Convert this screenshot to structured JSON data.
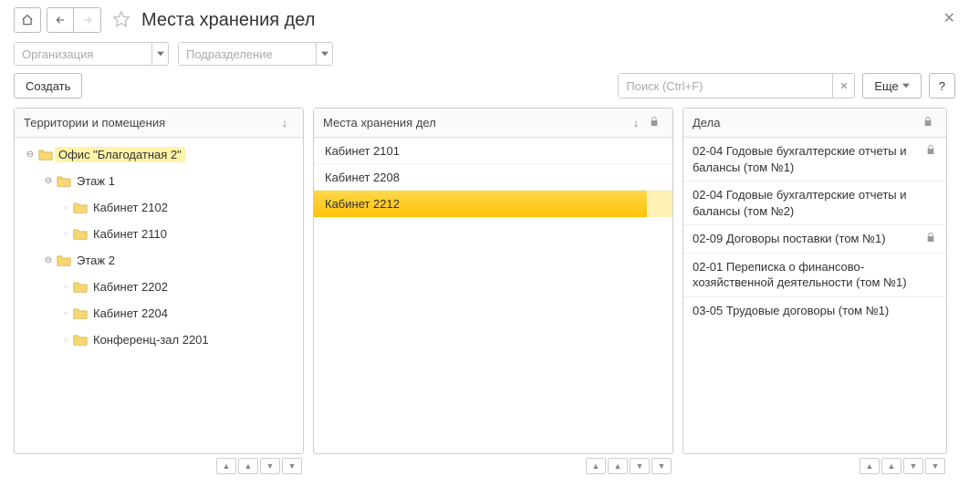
{
  "title": "Места хранения дел",
  "filters": {
    "org_placeholder": "Организация",
    "dept_placeholder": "Подразделение"
  },
  "actions": {
    "create_label": "Создать",
    "more_label": "Еще",
    "help_label": "?"
  },
  "search": {
    "placeholder": "Поиск (Ctrl+F)"
  },
  "panels": {
    "left": {
      "title": "Территории и помещения"
    },
    "mid": {
      "title": "Места хранения дел"
    },
    "right": {
      "title": "Дела"
    }
  },
  "tree": [
    {
      "level": 0,
      "expand": "⊖",
      "label": "Офис \"Благодатная 2\"",
      "selected": true
    },
    {
      "level": 1,
      "expand": "⊖",
      "label": "Этаж 1"
    },
    {
      "level": 2,
      "expand": "○",
      "label": "Кабинет 2102"
    },
    {
      "level": 2,
      "expand": "○",
      "label": "Кабинет 2110"
    },
    {
      "level": 1,
      "expand": "⊖",
      "label": "Этаж 2"
    },
    {
      "level": 2,
      "expand": "○",
      "label": "Кабинет 2202"
    },
    {
      "level": 2,
      "expand": "○",
      "label": "Кабинет 2204"
    },
    {
      "level": 2,
      "expand": "○",
      "label": "Конференц-зал 2201"
    }
  ],
  "mid_list": [
    {
      "label": "Кабинет 2101",
      "selected": false
    },
    {
      "label": "Кабинет 2208",
      "selected": false
    },
    {
      "label": "Кабинет 2212",
      "selected": true
    }
  ],
  "right_list": [
    {
      "label": "02-04 Годовые бухгалтерские отчеты и балансы (том №1)",
      "locked": true
    },
    {
      "label": "02-04 Годовые бухгалтерские отчеты и балансы (том №2)"
    },
    {
      "label": "02-09 Договоры поставки (том №1)",
      "locked": true
    },
    {
      "label": "02-01 Переписка о финансово-хозяйственной деятельности (том №1)"
    },
    {
      "label": "03-05 Трудовые договоры (том №1)"
    }
  ]
}
